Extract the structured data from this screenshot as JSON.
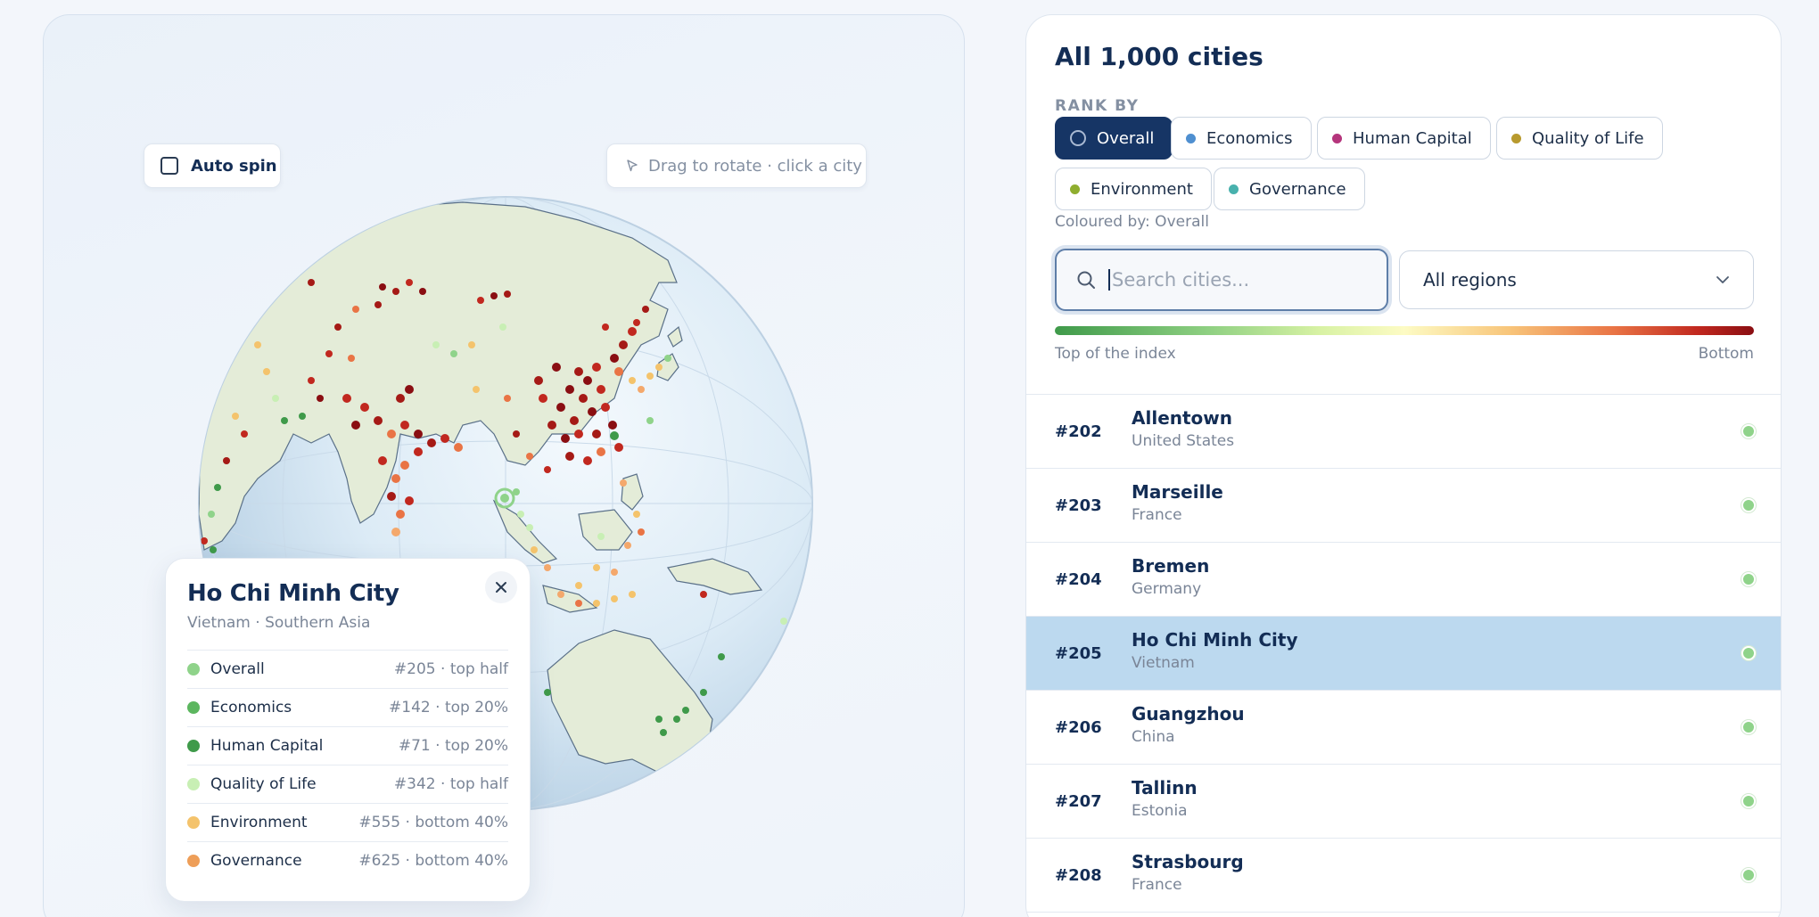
{
  "globe": {
    "auto_spin_label": "Auto spin",
    "hint": "Drag to rotate · click a city",
    "ocean_color": "#d2e4f3",
    "land_color": "#e4ecd8"
  },
  "popup": {
    "city": "Ho Chi Minh City",
    "subtitle": "Vietnam · Southern Asia",
    "close_icon": "close-icon",
    "metrics": [
      {
        "name": "Overall",
        "rank": "#205 · top half",
        "color": "#8fd38a"
      },
      {
        "name": "Economics",
        "rank": "#142 · top 20%",
        "color": "#5cb65f"
      },
      {
        "name": "Human Capital",
        "rank": "#71 · top 20%",
        "color": "#3f9a4a"
      },
      {
        "name": "Quality of Life",
        "rank": "#342 · top half",
        "color": "#c8efb4"
      },
      {
        "name": "Environment",
        "rank": "#555 · bottom 40%",
        "color": "#f4c36c"
      },
      {
        "name": "Governance",
        "rank": "#625 · bottom 40%",
        "color": "#ee9e58"
      }
    ]
  },
  "panel": {
    "title": "All 1,000 cities",
    "rank_by_label": "RANK BY",
    "chips": [
      {
        "label": "Overall",
        "color": "#163565",
        "active": true
      },
      {
        "label": "Economics",
        "color": "#4f8fd0"
      },
      {
        "label": "Human Capital",
        "color": "#b5357c"
      },
      {
        "label": "Quality of Life",
        "color": "#b89a2e"
      },
      {
        "label": "Environment",
        "color": "#8fae2f"
      },
      {
        "label": "Governance",
        "color": "#48b1ad"
      }
    ],
    "coloured_by": "Coloured by: Overall",
    "search_placeholder": "Search cities...",
    "region_value": "All regions",
    "legend_low": "Top of the index",
    "legend_high": "Bottom"
  },
  "cities": [
    {
      "rank": "#202",
      "name": "Allentown",
      "country": "United States"
    },
    {
      "rank": "#203",
      "name": "Marseille",
      "country": "France"
    },
    {
      "rank": "#204",
      "name": "Bremen",
      "country": "Germany"
    },
    {
      "rank": "#205",
      "name": "Ho Chi Minh City",
      "country": "Vietnam",
      "selected": true
    },
    {
      "rank": "#206",
      "name": "Guangzhou",
      "country": "China"
    },
    {
      "rank": "#207",
      "name": "Tallinn",
      "country": "Estonia"
    },
    {
      "rank": "#208",
      "name": "Strasbourg",
      "country": "France"
    }
  ]
}
